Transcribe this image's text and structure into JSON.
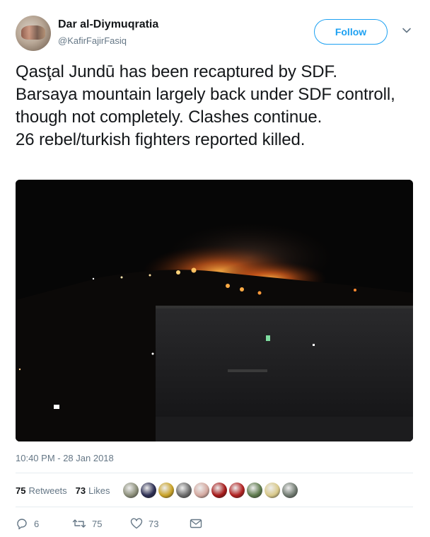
{
  "author": {
    "name": "Dar al-Diymuqratia",
    "handle": "@KafirFajirFasiq"
  },
  "follow_label": "Follow",
  "tweet_text": "Qasţal Jundū has been recaptured by SDF.\nBarsaya mountain largely back under SDF controll, though not completely. Clashes continue.\n26 rebel/turkish fighters reported killed.",
  "timestamp": "10:40 PM - 28 Jan 2018",
  "stats": {
    "retweets_count": "75",
    "retweets_label": "Retweets",
    "likes_count": "73",
    "likes_label": "Likes"
  },
  "likers": [
    "#8c8f7a",
    "#2b2d52",
    "#c9a227",
    "#6b6b6b",
    "#d4a9a0",
    "#a51818",
    "#b02020",
    "#5d7a4c",
    "#d9c98a",
    "#707a70"
  ],
  "actions": {
    "reply_count": "6",
    "retweet_count": "75",
    "like_count": "73"
  },
  "colors": {
    "accent": "#1da1f2",
    "muted": "#657786",
    "text": "#14171a"
  },
  "icons": {
    "reply": "reply-icon",
    "retweet": "retweet-icon",
    "like": "heart-icon",
    "dm": "envelope-icon",
    "caret": "chevron-down-icon"
  }
}
